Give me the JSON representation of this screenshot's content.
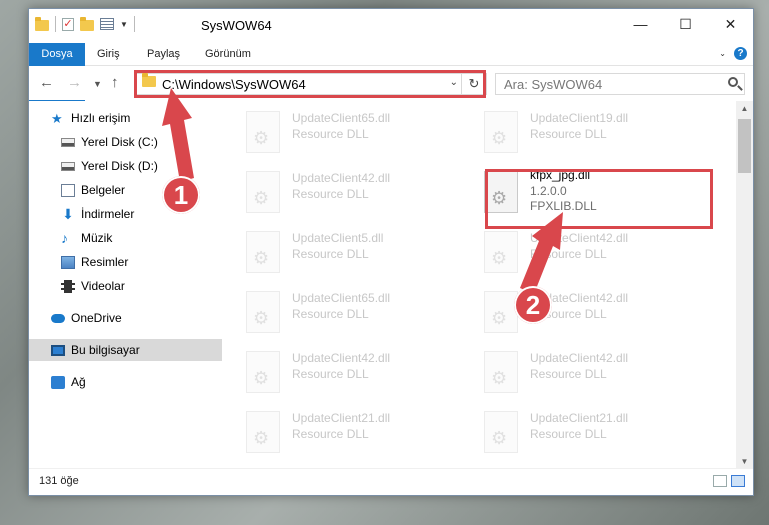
{
  "window": {
    "title": "SysWOW64",
    "controls": [
      "minimize-icon",
      "maximize-icon",
      "close-icon"
    ]
  },
  "ribbon": {
    "tabs": [
      "Dosya",
      "Giriş",
      "Paylaş",
      "Görünüm"
    ]
  },
  "nav": {
    "address": "C:\\Windows\\SysWOW64",
    "search_placeholder": "Ara: SysWOW64"
  },
  "sidebar": {
    "quick_access": "Hızlı erişim",
    "items": [
      {
        "label": "Yerel Disk (C:)",
        "icon": "drive-icon"
      },
      {
        "label": "Yerel Disk (D:)",
        "icon": "drive-icon"
      },
      {
        "label": "Belgeler",
        "icon": "documents-icon"
      },
      {
        "label": "İndirmeler",
        "icon": "downloads-icon"
      },
      {
        "label": "Müzik",
        "icon": "music-icon"
      },
      {
        "label": "Resimler",
        "icon": "pictures-icon"
      },
      {
        "label": "Videolar",
        "icon": "videos-icon"
      }
    ],
    "onedrive": "OneDrive",
    "this_pc": "Bu bilgisayar",
    "network": "Ağ"
  },
  "files": {
    "left": [
      {
        "name": "UpdateClient65.dll",
        "desc": "Resource DLL"
      },
      {
        "name": "UpdateClient42.dll",
        "desc": "Resource DLL"
      },
      {
        "name": "UpdateClient5.dll",
        "desc": "Resource DLL"
      },
      {
        "name": "UpdateClient65.dll",
        "desc": "Resource DLL"
      },
      {
        "name": "UpdateClient42.dll",
        "desc": "Resource DLL"
      },
      {
        "name": "UpdateClient21.dll",
        "desc": "Resource DLL"
      }
    ],
    "right": [
      {
        "name": "UpdateClient19.dll",
        "desc": "Resource DLL"
      },
      {
        "name": "UpdateClient42.dll",
        "desc": "Resource DLL"
      },
      {
        "name": "UpdateClient42.dll",
        "desc": "Resource DLL"
      },
      {
        "name": "UpdateClient42.dll",
        "desc": "Resource DLL"
      },
      {
        "name": "UpdateClient21.dll",
        "desc": "Resource DLL"
      }
    ],
    "target": {
      "name": "kfpx_jpg.dll",
      "version": "1.2.0.0",
      "desc": "FPXLIB.DLL"
    }
  },
  "status": {
    "count": "131 öğe"
  },
  "annotations": {
    "step1": "1",
    "step2": "2",
    "color": "#d9474c"
  }
}
